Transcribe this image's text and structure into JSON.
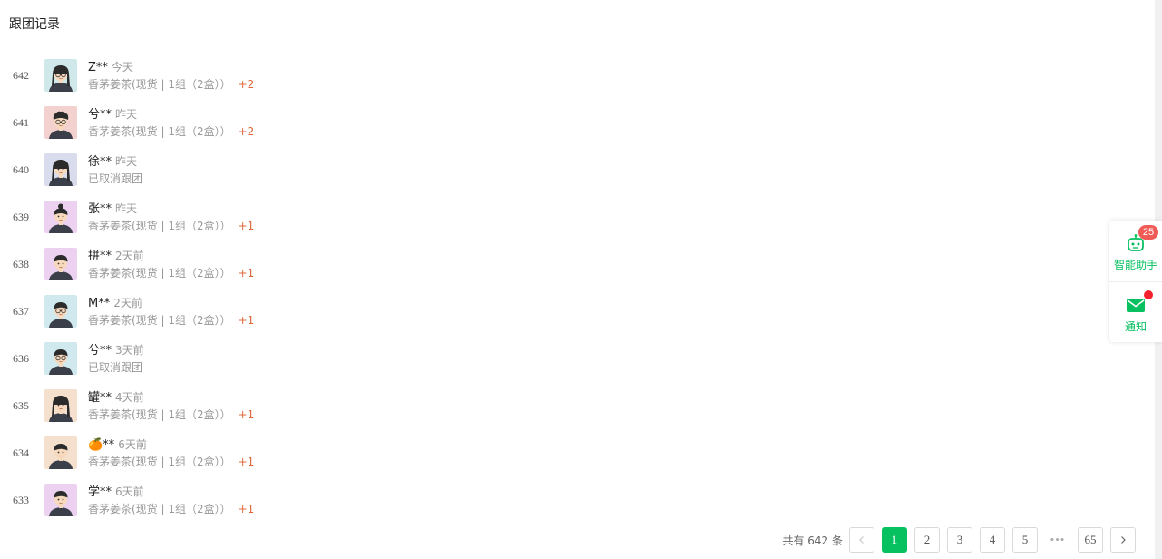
{
  "page_title": "跟团记录",
  "records": [
    {
      "no": "642",
      "name": "Z**",
      "time": "今天",
      "detail": "香茅姜茶(现货 | 1组（2盒））",
      "plus": "+2",
      "avatar_bg": "#cfe9ea",
      "avatar_icon": "person-avatar-glasses-long-hair"
    },
    {
      "no": "641",
      "name": "兮**",
      "time": "昨天",
      "detail": "香茅姜茶(现货 | 1组（2盒））",
      "plus": "+2",
      "avatar_bg": "#f3d1cf",
      "avatar_icon": "person-avatar-curly-glasses"
    },
    {
      "no": "640",
      "name": "徐**",
      "time": "昨天",
      "detail": "已取消跟团",
      "plus": "",
      "avatar_bg": "#d9dcec",
      "avatar_icon": "person-avatar-long-hair"
    },
    {
      "no": "639",
      "name": "张**",
      "time": "昨天",
      "detail": "香茅姜茶(现货 | 1组（2盒））",
      "plus": "+1",
      "avatar_bg": "#ecd1f1",
      "avatar_icon": "person-avatar-bun"
    },
    {
      "no": "638",
      "name": "拼**",
      "time": "2天前",
      "detail": "香茅姜茶(现货 | 1组（2盒））",
      "plus": "+1",
      "avatar_bg": "#ecd1f1",
      "avatar_icon": "person-avatar-short-hair"
    },
    {
      "no": "637",
      "name": "M**",
      "time": "2天前",
      "detail": "香茅姜茶(现货 | 1组（2盒））",
      "plus": "+1",
      "avatar_bg": "#cfe9ee",
      "avatar_icon": "person-avatar-glasses"
    },
    {
      "no": "636",
      "name": "兮**",
      "time": "3天前",
      "detail": "已取消跟团",
      "plus": "",
      "avatar_bg": "#cfe9ee",
      "avatar_icon": "person-avatar-glasses"
    },
    {
      "no": "635",
      "name": "罐**",
      "time": "4天前",
      "detail": "香茅姜茶(现货 | 1组（2盒））",
      "plus": "+1",
      "avatar_bg": "#f4e0cc",
      "avatar_icon": "person-avatar-long-hair"
    },
    {
      "no": "634",
      "name": "🍊**",
      "time": "6天前",
      "detail": "香茅姜茶(现货 | 1组（2盒））",
      "plus": "+1",
      "avatar_bg": "#f4e0cc",
      "avatar_icon": "person-avatar-short-hair"
    },
    {
      "no": "633",
      "name": "学**",
      "time": "6天前",
      "detail": "香茅姜茶(现货 | 1组（2盒））",
      "plus": "+1",
      "avatar_bg": "#ecd1f1",
      "avatar_icon": "person-avatar-short-hair"
    }
  ],
  "pagination": {
    "total_text": "共有 642 条",
    "prev_icon": "chevron-left-icon",
    "next_icon": "chevron-right-icon",
    "pages": [
      "1",
      "2",
      "3",
      "4",
      "5"
    ],
    "current": "1",
    "ellipsis": "•••",
    "last": "65"
  },
  "float_panel": {
    "assistant_label": "智能助手",
    "assistant_badge": "25",
    "assistant_icon": "robot-icon",
    "notice_label": "通知",
    "notice_icon": "envelope-icon"
  },
  "colors": {
    "accent": "#07c160",
    "plus_orange": "#e0683a",
    "badge_red": "#f05b57"
  }
}
